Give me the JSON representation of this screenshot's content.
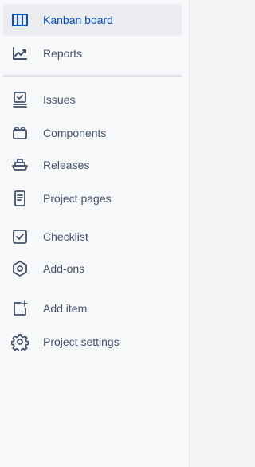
{
  "sidebar": {
    "items": [
      {
        "id": "kanban",
        "label": "Kanban board",
        "icon": "kanban-board-icon",
        "active": true
      },
      {
        "id": "reports",
        "label": "Reports",
        "icon": "reports-icon"
      },
      {
        "id": "issues",
        "label": "Issues",
        "icon": "issues-icon"
      },
      {
        "id": "components",
        "label": "Components",
        "icon": "components-icon"
      },
      {
        "id": "releases",
        "label": "Releases",
        "icon": "releases-icon"
      },
      {
        "id": "pages",
        "label": "Project pages",
        "icon": "project-pages-icon"
      },
      {
        "id": "checklist",
        "label": "Checklist",
        "icon": "checklist-icon"
      },
      {
        "id": "addons",
        "label": "Add-ons",
        "icon": "add-ons-icon"
      },
      {
        "id": "additem",
        "label": "Add item",
        "icon": "add-item-icon"
      },
      {
        "id": "settings",
        "label": "Project settings",
        "icon": "gear-icon"
      }
    ]
  },
  "colors": {
    "accent": "#0052cc",
    "text": "#42526e",
    "active_bg": "#ebecf0",
    "sidebar_bg": "#f7f8fa"
  }
}
